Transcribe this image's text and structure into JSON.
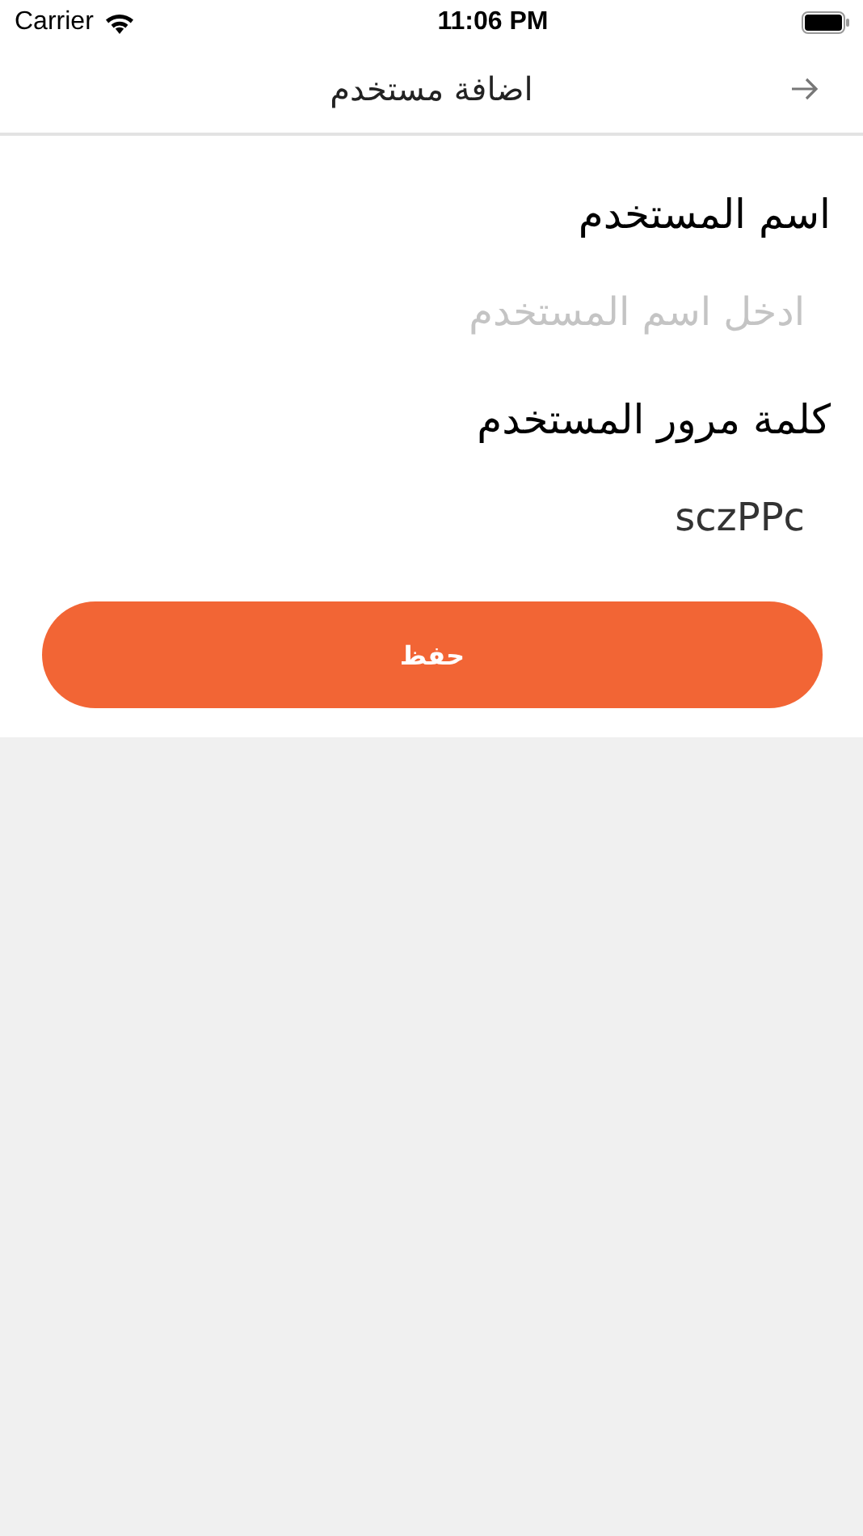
{
  "status_bar": {
    "carrier": "Carrier",
    "time": "11:06 PM"
  },
  "nav_bar": {
    "title": "اضافة مستخدم"
  },
  "form": {
    "fields": [
      {
        "label": "اسم المستخدم",
        "placeholder": "ادخل اسم المستخدم"
      },
      {
        "label": "كلمة مرور المستخدم",
        "value": "sczPPc"
      }
    ],
    "save_button": "حفظ"
  }
}
